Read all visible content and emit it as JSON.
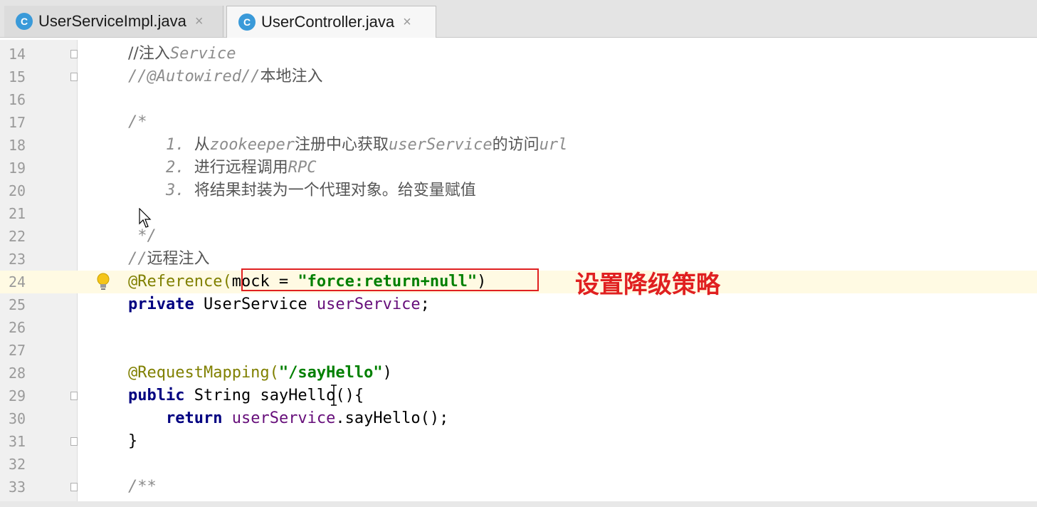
{
  "tabs": [
    {
      "label": "UserServiceImpl.java",
      "icon": "c-class-icon",
      "icon_letter": "C",
      "close": "×"
    },
    {
      "label": "UserController.java",
      "icon": "c-class-icon",
      "icon_letter": "C",
      "close": "×"
    }
  ],
  "annotation_note": "设置降级策略",
  "colors": {
    "highlight_box": "#e02020",
    "keyword": "#000080",
    "annotation": "#808000",
    "string": "#008000",
    "field": "#660e7a",
    "comment": "#8c8c8c",
    "current_line": "#fffae3"
  },
  "lines": [
    {
      "n": "14",
      "p": [
        "//注入",
        "Service"
      ]
    },
    {
      "n": "15",
      "p": [
        "//@Autowired//",
        "本地注入"
      ]
    },
    {
      "n": "16"
    },
    {
      "n": "17",
      "p": [
        "/*"
      ]
    },
    {
      "n": "18",
      "p": [
        "    1. ",
        "从",
        "zookeeper",
        "注册中心获取",
        "userService",
        "的访问",
        "url"
      ]
    },
    {
      "n": "19",
      "p": [
        "    2. ",
        "进行远程调用",
        "RPC"
      ]
    },
    {
      "n": "20",
      "p": [
        "    3. ",
        "将结果封装为一个代理对象。给变量赋值"
      ]
    },
    {
      "n": "21"
    },
    {
      "n": "22",
      "p": [
        " */"
      ]
    },
    {
      "n": "23",
      "p": [
        "//",
        "远程注入"
      ]
    },
    {
      "n": "24",
      "p": [
        "@Reference(",
        "mock = ",
        "\"force:return+null\"",
        ")"
      ]
    },
    {
      "n": "25",
      "p": [
        "private",
        " UserService ",
        "userService",
        ";"
      ]
    },
    {
      "n": "26"
    },
    {
      "n": "27"
    },
    {
      "n": "28",
      "p": [
        "@RequestMapping(",
        "\"/sayHello\"",
        ")"
      ]
    },
    {
      "n": "29",
      "p": [
        "public",
        " String sayHello(){"
      ]
    },
    {
      "n": "30",
      "p": [
        "    ",
        "return",
        " ",
        "userService",
        ".sayHello();"
      ]
    },
    {
      "n": "31",
      "p": [
        "}"
      ]
    },
    {
      "n": "32"
    },
    {
      "n": "33",
      "p": [
        "/**"
      ]
    }
  ]
}
